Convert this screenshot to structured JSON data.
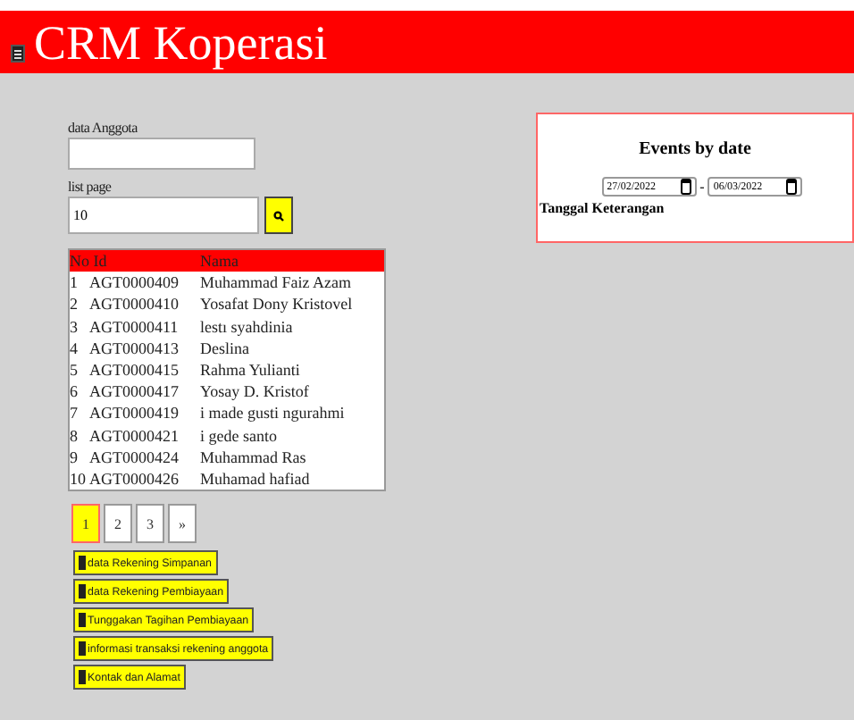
{
  "header": {
    "title": "CRM Koperasi"
  },
  "search": {
    "member_label": "data Anggota",
    "list_page_label": "list page",
    "list_page_value": "10"
  },
  "table": {
    "columns": [
      "No Id",
      "Nama"
    ],
    "rows": [
      {
        "no": "1",
        "id": "AGT0000409",
        "nama": "Muhammad Faiz Azam"
      },
      {
        "no": "2",
        "id": "AGT0000410",
        "nama": "Yosafat Dony Kristovel"
      },
      {
        "no": "3",
        "id": "AGT0000411",
        "nama": "lestı syahdinia"
      },
      {
        "no": "4",
        "id": "AGT0000413",
        "nama": "Deslina"
      },
      {
        "no": "5",
        "id": "AGT0000415",
        "nama": "Rahma Yulianti"
      },
      {
        "no": "6",
        "id": "AGT0000417",
        "nama": "Yosay D. Kristof"
      },
      {
        "no": "7",
        "id": "AGT0000419",
        "nama": "i made gusti ngurahmi"
      },
      {
        "no": "8",
        "id": "AGT0000421",
        "nama": "i gede santo"
      },
      {
        "no": "9",
        "id": "AGT0000424",
        "nama": "Muhammad Ras"
      },
      {
        "no": "10",
        "id": "AGT0000426",
        "nama": "Muhamad hafiad"
      }
    ]
  },
  "pagination": [
    {
      "label": "1",
      "selected": true
    },
    {
      "label": "2",
      "selected": false
    },
    {
      "label": "3",
      "selected": false
    },
    {
      "label": "»",
      "selected": false
    }
  ],
  "links": [
    "data Rekening Simpanan",
    "data Rekening Pembiayaan",
    "Tunggakan Tagihan Pembiayaan",
    "informasi transaksi rekening anggota",
    "Kontak dan Alamat"
  ],
  "events": {
    "title": "Events by date",
    "date_from": "27/02/2022",
    "separator": "-",
    "date_to": "06/03/2022",
    "columns_label": "Tanggal Keterangan"
  }
}
